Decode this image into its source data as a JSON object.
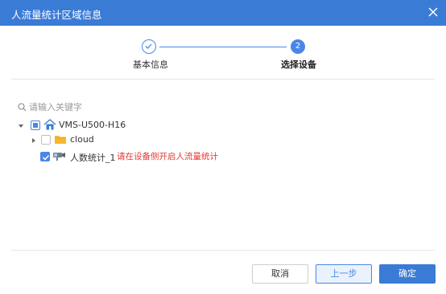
{
  "dialog": {
    "title": "人流量统计区域信息",
    "close_icon": "close-icon"
  },
  "steps": [
    {
      "label": "基本信息",
      "state": "done",
      "icon": "check-icon"
    },
    {
      "label": "选择设备",
      "number": "2",
      "state": "active"
    }
  ],
  "search": {
    "placeholder": "请输入关键字",
    "value": ""
  },
  "tree": {
    "root": {
      "label": "VMS-U500-H16",
      "icon": "home-icon",
      "check_state": "partial",
      "expanded": true
    },
    "children": [
      {
        "label": "cloud",
        "icon": "folder-icon",
        "check_state": "unchecked",
        "expanded": false
      },
      {
        "label": "人数统计_1",
        "icon": "camera-icon",
        "check_state": "checked",
        "hint": "请在设备侧开启人流量统计"
      }
    ]
  },
  "footer": {
    "cancel_label": "取消",
    "prev_label": "上一步",
    "ok_label": "确定"
  },
  "colors": {
    "accent": "#3a7bd5",
    "step": "#4a86e8",
    "warning": "#e53935"
  }
}
